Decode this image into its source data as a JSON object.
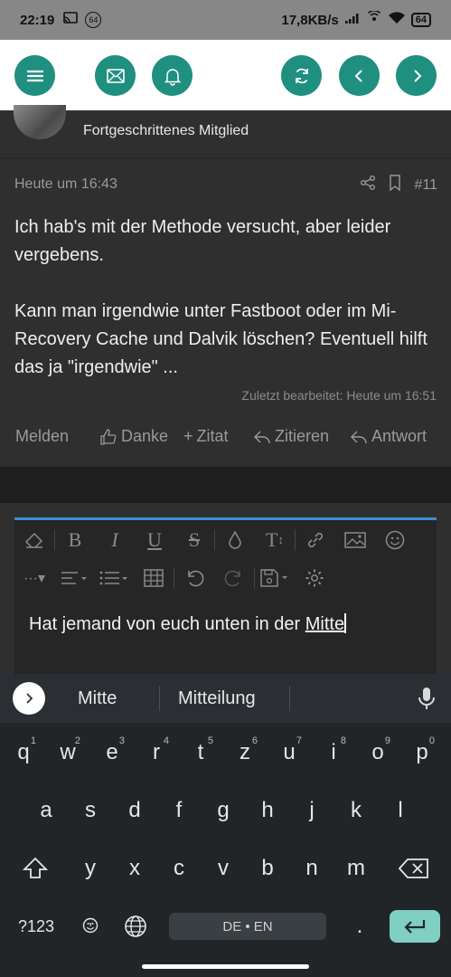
{
  "status_bar": {
    "time": "22:19",
    "badge": "64",
    "speed": "17,8KB/s",
    "battery": "64"
  },
  "nav": {
    "menu_icon": "menu-icon",
    "mail_icon": "mail-icon",
    "bell_icon": "bell-icon",
    "refresh_icon": "refresh-icon",
    "back_icon": "chevron-left-icon",
    "forward_icon": "chevron-right-icon",
    "accent": "#1f8f80"
  },
  "author": {
    "role": "Fortgeschrittenes Mitglied"
  },
  "post": {
    "date": "Heute um 16:43",
    "number": "#11",
    "paragraphs": [
      "Ich hab's mit der Methode versucht, aber leider vergebens.",
      "Kann man irgendwie unter Fastboot oder im Mi-Recovery Cache und Dalvik löschen? Eventuell hilft das ja \"irgendwie\" ..."
    ],
    "edited": "Zuletzt bearbeitet: Heute um 16:51",
    "actions": {
      "report": "Melden",
      "thanks": "Danke",
      "quote_add": "Zitat",
      "quote": "Zitieren",
      "reply": "Antwort"
    }
  },
  "editor": {
    "text_before": "Hat jemand von euch unten in der ",
    "text_current": "Mitte",
    "accent": "#3b8fd6"
  },
  "suggestions": {
    "items": [
      "Mitte",
      "Mitteilung"
    ]
  },
  "keyboard": {
    "row1": [
      {
        "k": "q",
        "h": "1"
      },
      {
        "k": "w",
        "h": "2"
      },
      {
        "k": "e",
        "h": "3"
      },
      {
        "k": "r",
        "h": "4"
      },
      {
        "k": "t",
        "h": "5"
      },
      {
        "k": "z",
        "h": "6"
      },
      {
        "k": "u",
        "h": "7"
      },
      {
        "k": "i",
        "h": "8"
      },
      {
        "k": "o",
        "h": "9"
      },
      {
        "k": "p",
        "h": "0"
      }
    ],
    "row2": [
      "a",
      "s",
      "d",
      "f",
      "g",
      "h",
      "j",
      "k",
      "l"
    ],
    "row3": [
      "y",
      "x",
      "c",
      "v",
      "b",
      "n",
      "m"
    ],
    "symbols": "?123",
    "comma": ",",
    "space": "DE • EN",
    "period": ".",
    "enter_color": "#7fcfc3"
  }
}
